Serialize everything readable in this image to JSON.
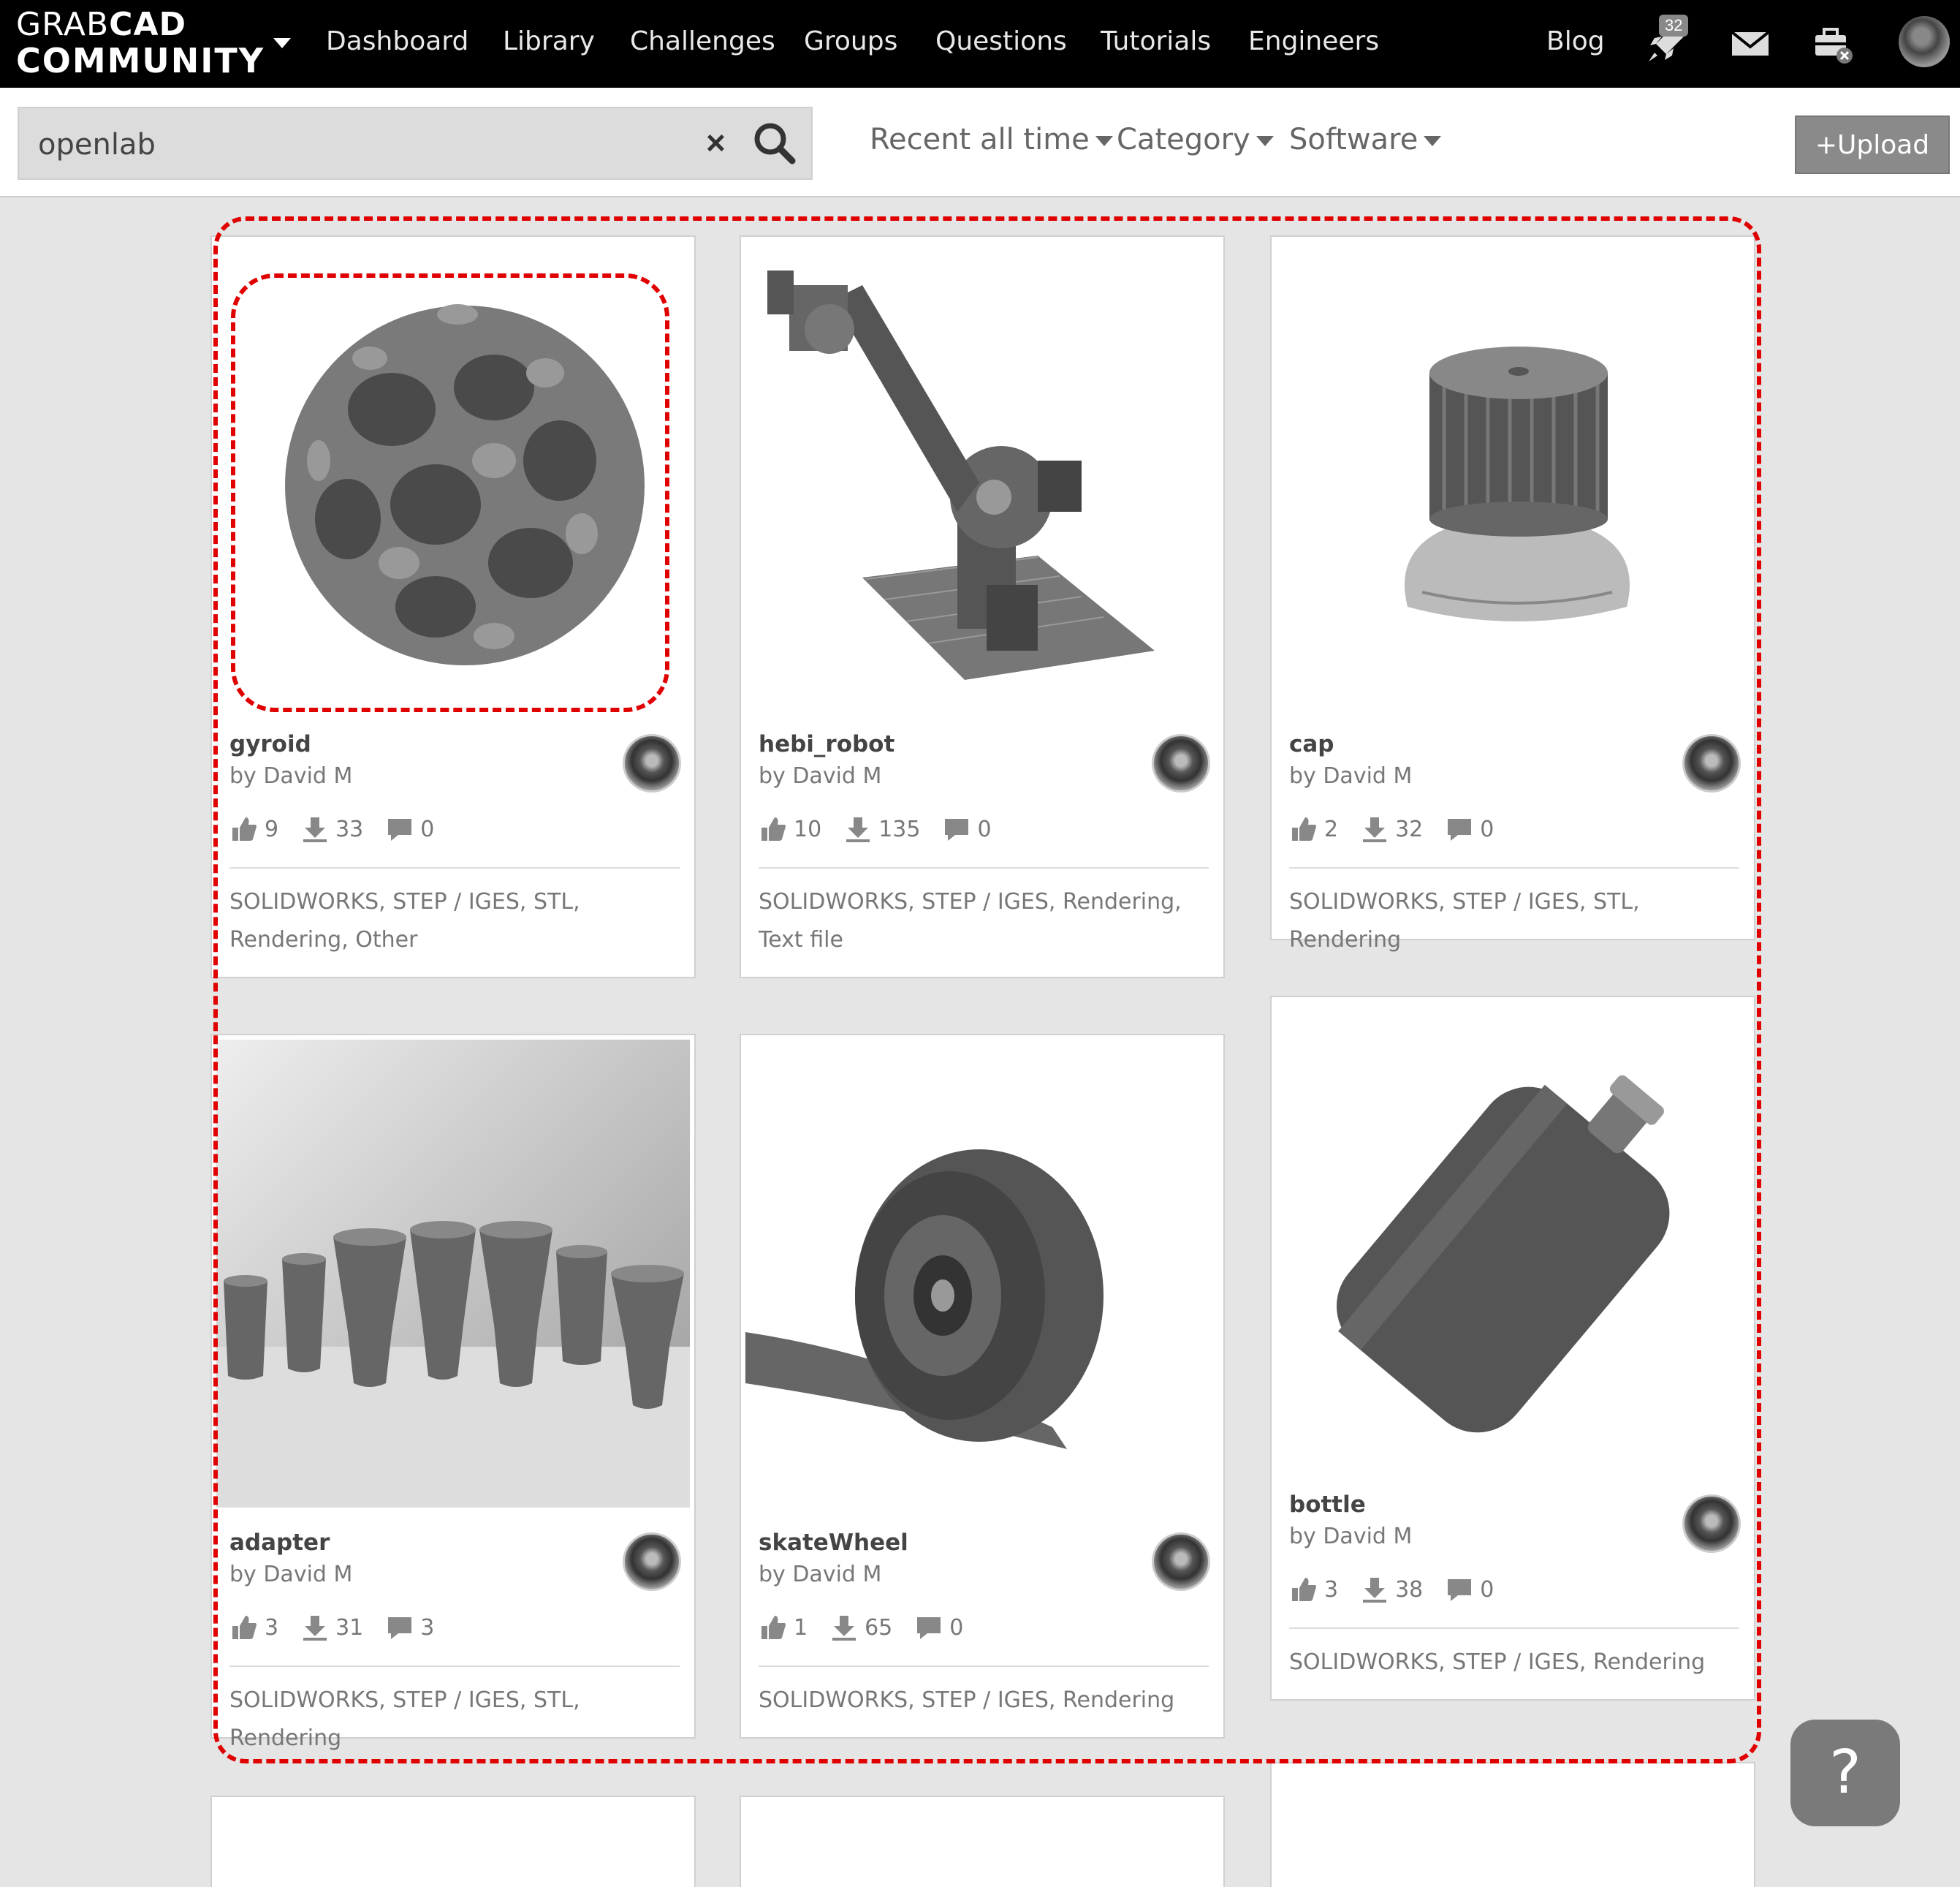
{
  "logo": {
    "line1_a": "GRAB",
    "line1_b": "CAD",
    "line2": "COMMUNITY"
  },
  "nav": {
    "links": [
      "Dashboard",
      "Library",
      "Challenges",
      "Groups",
      "Questions",
      "Tutorials",
      "Engineers"
    ],
    "blog": "Blog",
    "notification_count": "32",
    "icons": [
      "rocket-icon",
      "mail-icon",
      "briefcase-icon",
      "avatar"
    ]
  },
  "search": {
    "value": "openlab",
    "clear_symbol": "×"
  },
  "filters": {
    "sort": "Recent all time",
    "category": "Category",
    "software": "Software"
  },
  "upload_label": "+Upload",
  "cards": [
    {
      "title": "gyroid",
      "author": "by David M",
      "likes": "9",
      "downloads": "33",
      "comments": "0",
      "tags": "SOLIDWORKS, STEP / IGES, STL, Rendering, Other"
    },
    {
      "title": "hebi_robot",
      "author": "by David M",
      "likes": "10",
      "downloads": "135",
      "comments": "0",
      "tags": "SOLIDWORKS, STEP / IGES, Rendering, Text file"
    },
    {
      "title": "cap",
      "author": "by David M",
      "likes": "2",
      "downloads": "32",
      "comments": "0",
      "tags": "SOLIDWORKS, STEP / IGES, STL, Rendering"
    },
    {
      "title": "adapter",
      "author": "by David M",
      "likes": "3",
      "downloads": "31",
      "comments": "3",
      "tags": "SOLIDWORKS, STEP / IGES, STL, Rendering"
    },
    {
      "title": "skateWheel",
      "author": "by David M",
      "likes": "1",
      "downloads": "65",
      "comments": "0",
      "tags": "SOLIDWORKS, STEP / IGES, Rendering"
    },
    {
      "title": "bottle",
      "author": "by David M",
      "likes": "3",
      "downloads": "38",
      "comments": "0",
      "tags": "SOLIDWORKS, STEP / IGES, Rendering"
    }
  ],
  "help_label": "?",
  "colors": {
    "topbar": "#000000",
    "highlight": "#e00000",
    "page_bg": "#e5e5e5"
  }
}
